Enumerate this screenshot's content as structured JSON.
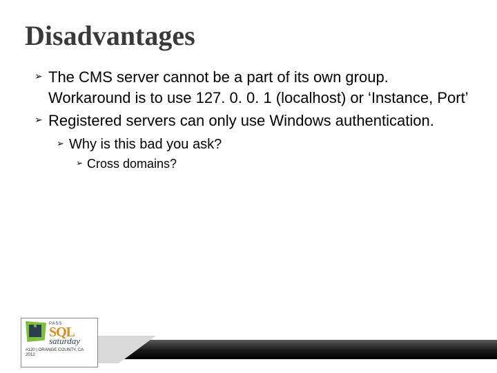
{
  "title": "Disadvantages",
  "bullets": {
    "b1a": "The CMS server cannot be a part of its own group. Workaround is to use 127. 0. 0. 1 (localhost) or ‘Instance, Port’",
    "b1b": "Registered servers can only use Windows authentication.",
    "b2": "Why is this bad you ask?",
    "b3": "Cross domains?"
  },
  "logo": {
    "pass": "PASS",
    "sql": "SQL",
    "sat": "saturday",
    "tag": "#120 | ORANGE COUNTY, CA 2012"
  }
}
